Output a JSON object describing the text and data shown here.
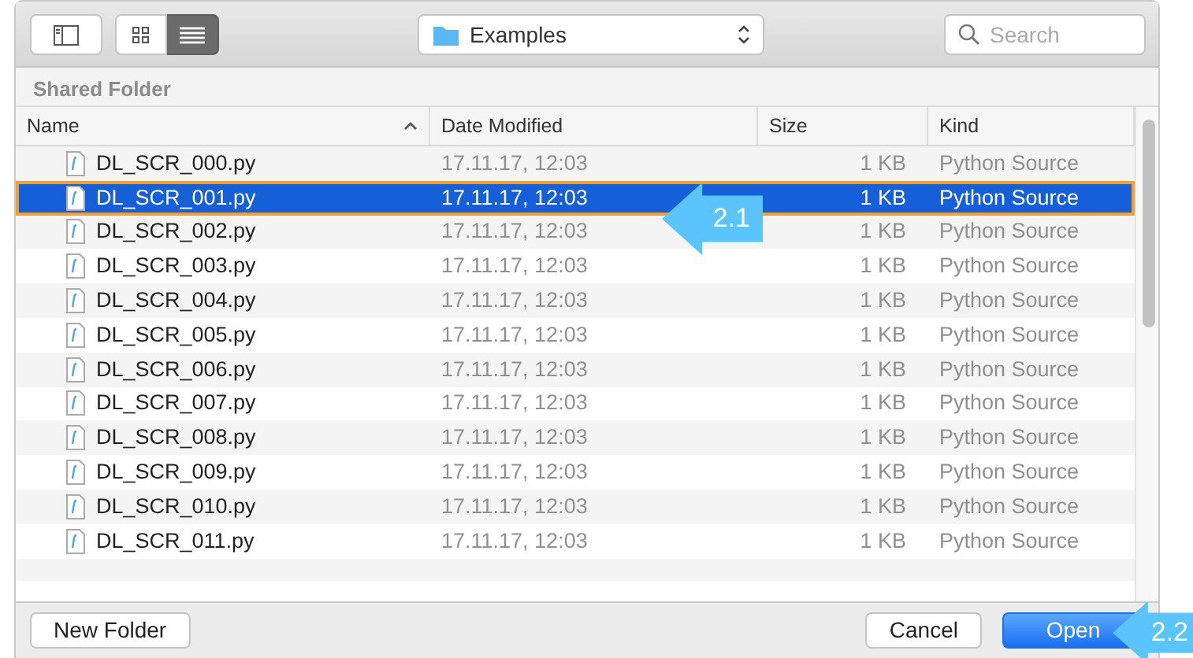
{
  "toolbar": {
    "view_modes": [
      {
        "kind": "icons",
        "selected": false
      },
      {
        "kind": "list",
        "selected": true
      }
    ],
    "location": "Examples",
    "search": {
      "placeholder": "Search"
    }
  },
  "section_title": "Shared Folder",
  "columns": [
    {
      "label": "Name",
      "sorted": true
    },
    {
      "label": "Date Modified",
      "sorted": false
    },
    {
      "label": "Size",
      "sorted": false
    },
    {
      "label": "Kind",
      "sorted": false
    }
  ],
  "rows": [
    {
      "name": "DL_SCR_000.py",
      "date": "17.11.17, 12:03",
      "size": "1 KB",
      "kind": "Python Source",
      "selected": false
    },
    {
      "name": "DL_SCR_001.py",
      "date": "17.11.17, 12:03",
      "size": "1 KB",
      "kind": "Python Source",
      "selected": true
    },
    {
      "name": "DL_SCR_002.py",
      "date": "17.11.17, 12:03",
      "size": "1 KB",
      "kind": "Python Source",
      "selected": false
    },
    {
      "name": "DL_SCR_003.py",
      "date": "17.11.17, 12:03",
      "size": "1 KB",
      "kind": "Python Source",
      "selected": false
    },
    {
      "name": "DL_SCR_004.py",
      "date": "17.11.17, 12:03",
      "size": "1 KB",
      "kind": "Python Source",
      "selected": false
    },
    {
      "name": "DL_SCR_005.py",
      "date": "17.11.17, 12:03",
      "size": "1 KB",
      "kind": "Python Source",
      "selected": false
    },
    {
      "name": "DL_SCR_006.py",
      "date": "17.11.17, 12:03",
      "size": "1 KB",
      "kind": "Python Source",
      "selected": false
    },
    {
      "name": "DL_SCR_007.py",
      "date": "17.11.17, 12:03",
      "size": "1 KB",
      "kind": "Python Source",
      "selected": false
    },
    {
      "name": "DL_SCR_008.py",
      "date": "17.11.17, 12:03",
      "size": "1 KB",
      "kind": "Python Source",
      "selected": false
    },
    {
      "name": "DL_SCR_009.py",
      "date": "17.11.17, 12:03",
      "size": "1 KB",
      "kind": "Python Source",
      "selected": false
    },
    {
      "name": "DL_SCR_010.py",
      "date": "17.11.17, 12:03",
      "size": "1 KB",
      "kind": "Python Source",
      "selected": false
    },
    {
      "name": "DL_SCR_011.py",
      "date": "17.11.17, 12:03",
      "size": "1 KB",
      "kind": "Python Source",
      "selected": false
    }
  ],
  "buttons": [
    {
      "label": "New Folder",
      "kind": "plain"
    },
    {
      "label": "Cancel",
      "kind": "plain"
    },
    {
      "label": "Open",
      "kind": "default"
    }
  ],
  "callouts": [
    {
      "label": "2.1"
    },
    {
      "label": "2.2"
    }
  ]
}
